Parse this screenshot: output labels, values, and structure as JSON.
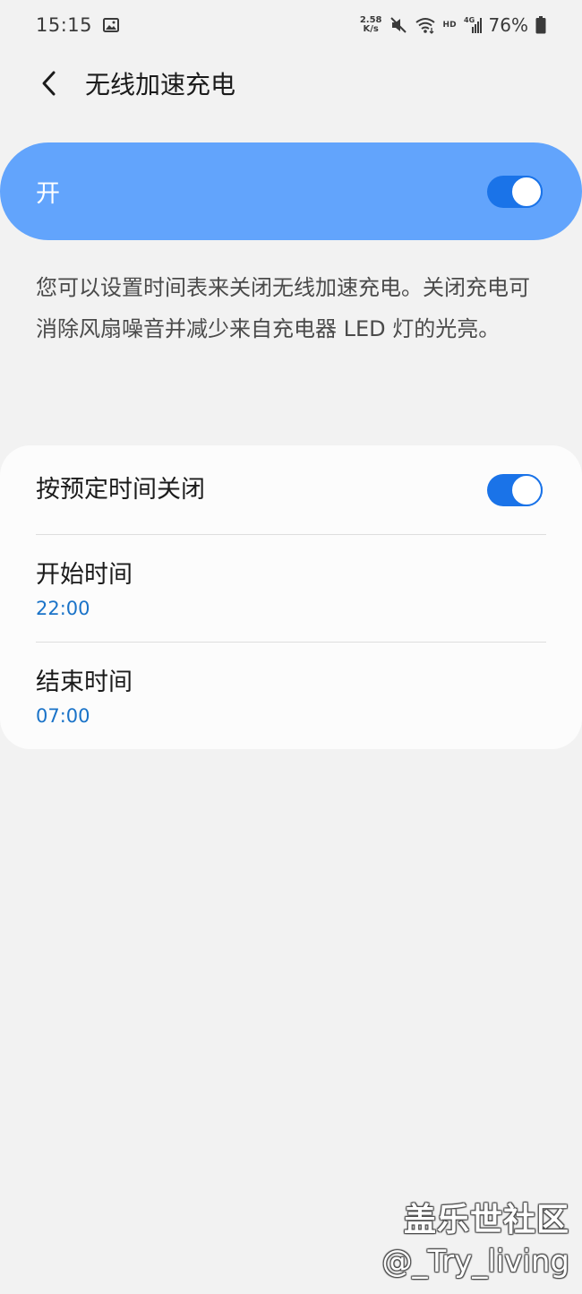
{
  "status_bar": {
    "time": "15:15",
    "net_speed_value": "2.58",
    "net_speed_unit": "K/s",
    "hd_label": "HD",
    "signal_label": "4G",
    "battery": "76%",
    "icons": [
      "gallery-icon",
      "mute-icon",
      "wifi-icon",
      "signal-icon",
      "battery-icon"
    ]
  },
  "header": {
    "back_icon": "chevron-left-icon",
    "title": "无线加速充电"
  },
  "master_switch": {
    "label": "开",
    "state": "on",
    "bar_color": "#62a4fc"
  },
  "description": "您可以设置时间表来关闭无线加速充电。关闭充电可消除风扇噪音并减少来自充电器 LED 灯的光亮。",
  "schedule_card": {
    "schedule_toggle": {
      "label": "按预定时间关闭",
      "state": "on"
    },
    "start_time": {
      "label": "开始时间",
      "value": "22:00"
    },
    "end_time": {
      "label": "结束时间",
      "value": "07:00"
    }
  },
  "watermark": {
    "line1": "盖乐世社区",
    "line2": "@_Try_living"
  },
  "colors": {
    "accent": "#1a73e8",
    "time_value": "#1a73c8",
    "background": "#f2f2f2",
    "card": "#fcfcfc"
  }
}
